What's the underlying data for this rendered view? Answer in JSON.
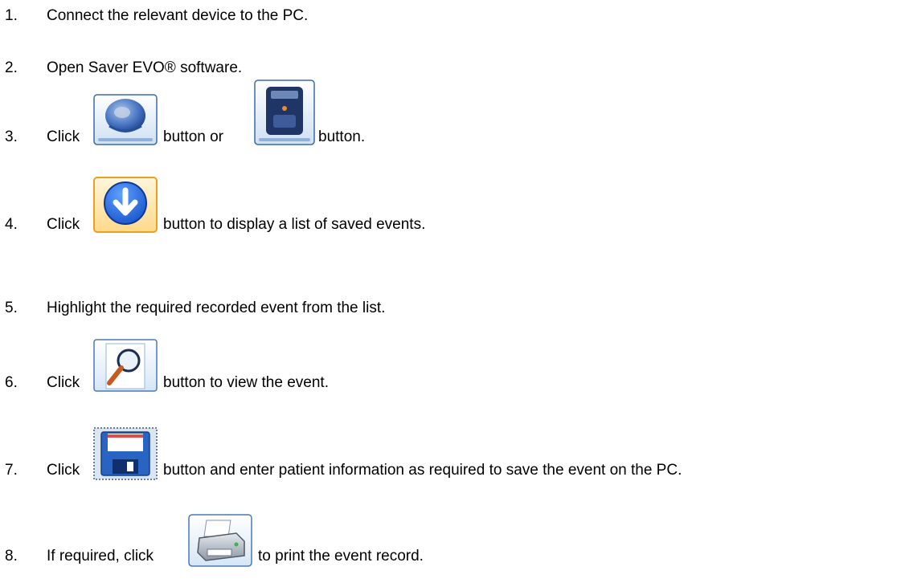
{
  "steps": [
    {
      "number": "1.",
      "text": "Connect the relevant device to the PC."
    },
    {
      "number": "2.",
      "text": "Open Saver EVO® software."
    },
    {
      "number": "3.",
      "text_before": "Click",
      "text_middle": "button or",
      "text_after": "button.",
      "icons": [
        "disc-device-icon",
        "defibrillator-device-icon"
      ]
    },
    {
      "number": "4.",
      "text_before": "Click",
      "text_after": "button to display a list of saved events.",
      "icons": [
        "download-arrow-icon"
      ]
    },
    {
      "number": "5.",
      "text": "Highlight the required recorded event from the list."
    },
    {
      "number": "6.",
      "text_before": "Click",
      "text_after": "button to view the event.",
      "icons": [
        "magnifier-view-icon"
      ]
    },
    {
      "number": "7.",
      "text_before": "Click",
      "text_after": "button and enter patient information as required to save the event on the PC.",
      "icons": [
        "floppy-save-icon"
      ]
    },
    {
      "number": "8.",
      "text_before": "If required, click",
      "text_after": "to print the event record.",
      "icons": [
        "printer-icon"
      ]
    }
  ]
}
